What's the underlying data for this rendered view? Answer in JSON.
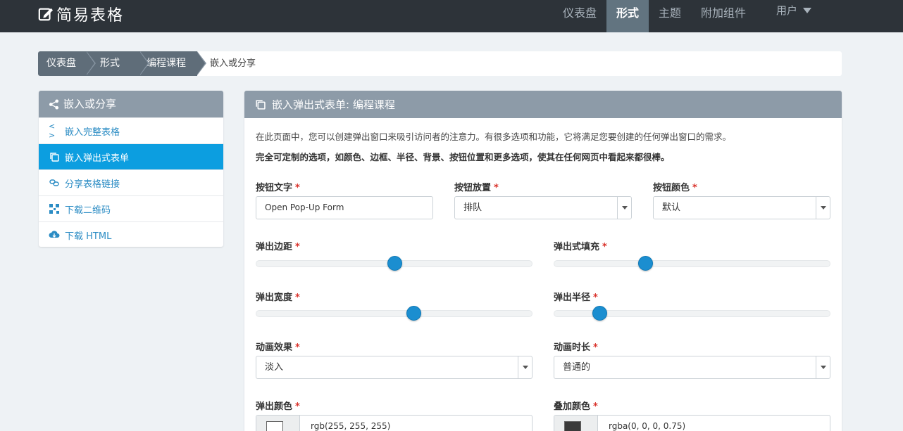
{
  "app": {
    "title": "简易表格"
  },
  "nav": {
    "items": [
      "仪表盘",
      "形式",
      "主题",
      "附加组件"
    ],
    "active_index": 1,
    "user_label": "用户"
  },
  "breadcrumb": {
    "items": [
      "仪表盘",
      "形式",
      "编程课程"
    ],
    "current": "嵌入或分享"
  },
  "sidebar": {
    "title": "嵌入或分享",
    "items": [
      {
        "label": "嵌入完整表格",
        "icon": "code-icon"
      },
      {
        "label": "嵌入弹出式表单",
        "icon": "copy-icon",
        "active": true
      },
      {
        "label": "分享表格链接",
        "icon": "link-icon"
      },
      {
        "label": "下载二维码",
        "icon": "qrcode-icon"
      },
      {
        "label": "下载 HTML",
        "icon": "cloud-download-icon"
      }
    ]
  },
  "main": {
    "title": "嵌入弹出式表单: 编程课程",
    "intro": "在此页面中，您可以创建弹出窗口来吸引访问者的注意力。有很多选项和功能，它将满足您要创建的任何弹出窗口的需求。",
    "intro_bold": "完全可定制的选项，如颜色、边框、半径、背景、按钮位置和更多选项，使其在任何网页中看起来都很棒。",
    "required_mark": "*",
    "fields": {
      "button_text": {
        "label": "按钮文字",
        "value": "Open Pop-Up Form"
      },
      "button_placement": {
        "label": "按钮放置",
        "value": "排队"
      },
      "button_color": {
        "label": "按钮颜色",
        "value": "默认"
      },
      "popup_margin": {
        "label": "弹出边距",
        "level": 0.5
      },
      "popup_padding": {
        "label": "弹出式填充",
        "level": 0.33
      },
      "popup_width": {
        "label": "弹出宽度",
        "level": 0.57
      },
      "popup_radius": {
        "label": "弹出半径",
        "level": 0.165
      },
      "animation_effect": {
        "label": "动画效果",
        "value": "淡入"
      },
      "animation_duration": {
        "label": "动画时长",
        "value": "普通的"
      },
      "popup_color": {
        "label": "弹出颜色",
        "value": "rgb(255, 255, 255)",
        "swatch": "#ffffff"
      },
      "overlay_color": {
        "label": "叠加颜色",
        "value": "rgba(0, 0, 0, 0.75)",
        "swatch": "#3a3a3a"
      }
    }
  },
  "colors": {
    "topbar": "#2d3339",
    "nav_active": "#627480",
    "panel_header": "#8d9ba8",
    "accent": "#0c9ee0",
    "slider": "#1b8ed0",
    "required": "#d9322b"
  }
}
